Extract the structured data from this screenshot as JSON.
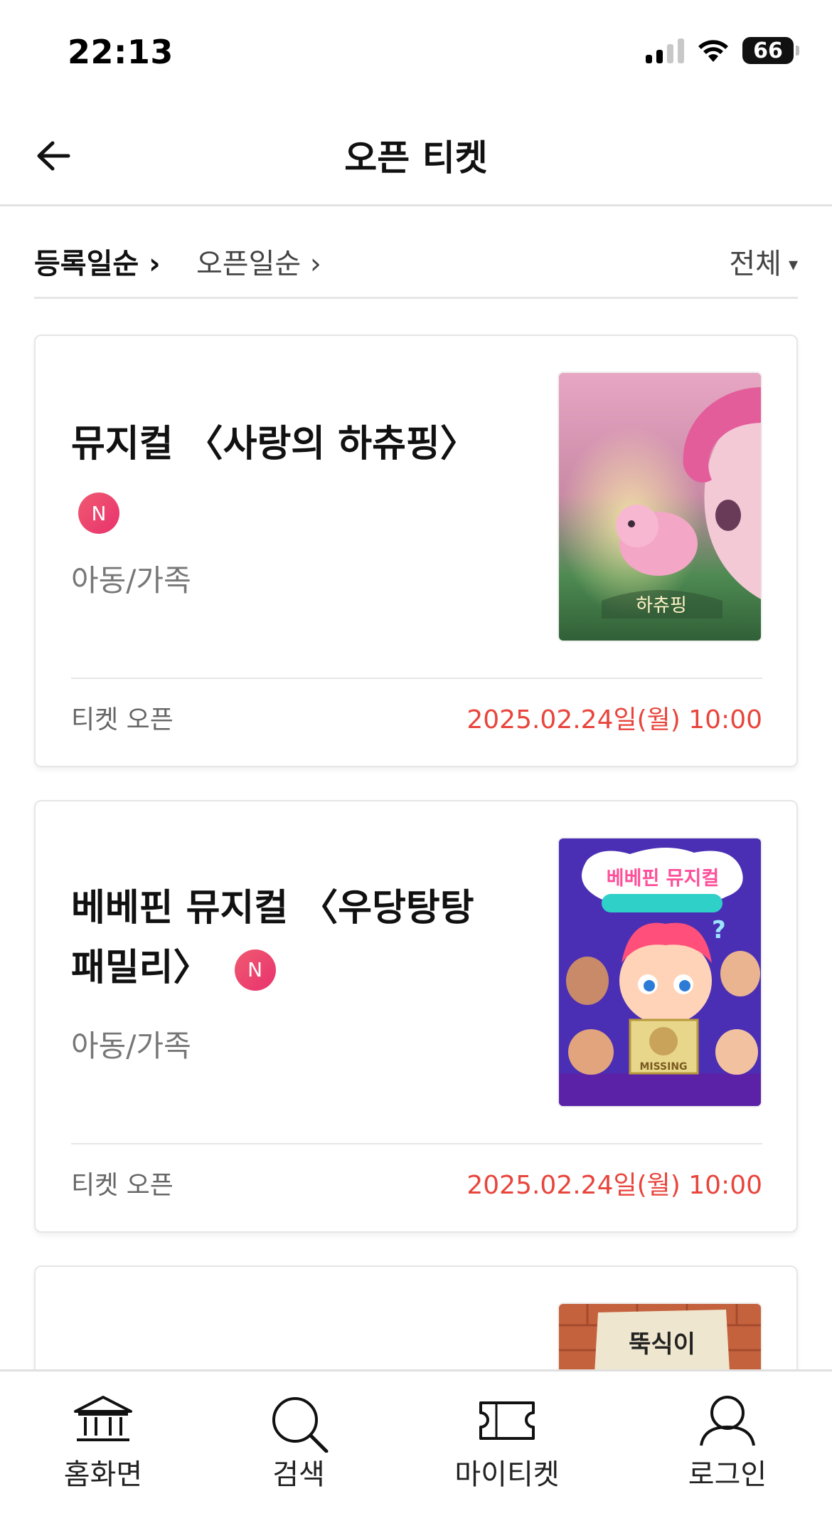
{
  "status_bar": {
    "time": "22:13",
    "battery": "66",
    "icons": [
      "signal-icon",
      "wifi-icon",
      "battery-icon"
    ]
  },
  "header": {
    "title": "오픈 티켓",
    "back_icon": "arrow-left-icon"
  },
  "sort_bar": {
    "tabs": [
      {
        "label": "등록일순 ›",
        "active": true
      },
      {
        "label": "오픈일순 ›",
        "active": false
      }
    ],
    "filter": {
      "label": "전체",
      "caret": "▾"
    }
  },
  "cards": [
    {
      "title": "뮤지컬 〈사랑의 하츄핑〉",
      "badge": "N",
      "category": "아동/가족",
      "open_label": "티켓 오픈",
      "open_date": "2025.02.24일(월) 10:00"
    },
    {
      "title": "베베핀 뮤지컬 〈우당탕탕 패밀리〉",
      "badge": "N",
      "category": "아동/가족",
      "open_label": "티켓 오픈",
      "open_date": "2025.02.24일(월) 10:00",
      "poster_text": {
        "heading": "베베핀 뮤지컬",
        "sign": "MISSING"
      }
    },
    {
      "title": "",
      "poster_text": {
        "heading": "뚝식이"
      }
    }
  ],
  "bottom_nav": {
    "items": [
      {
        "label": "홈화면",
        "icon": "museum-icon"
      },
      {
        "label": "검색",
        "icon": "search-icon"
      },
      {
        "label": "마이티켓",
        "icon": "ticket-icon"
      },
      {
        "label": "로그인",
        "icon": "user-icon"
      }
    ]
  },
  "colors": {
    "accent_red": "#e8453c",
    "badge": "#e8326e"
  }
}
